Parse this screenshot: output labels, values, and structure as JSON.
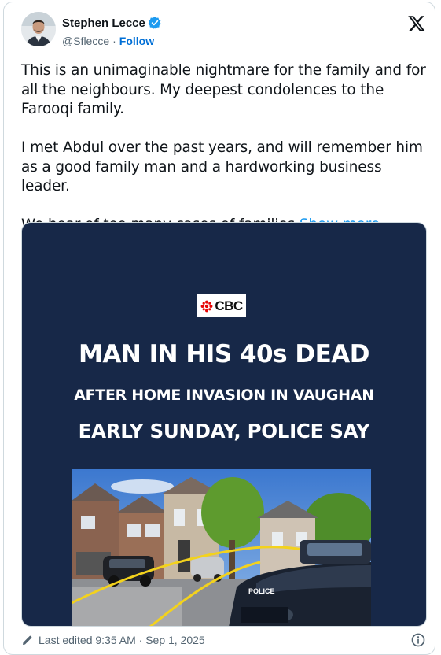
{
  "author": {
    "display_name": "Stephen Lecce",
    "handle": "@Sflecce",
    "separator": "·",
    "follow_label": "Follow"
  },
  "post": {
    "paragraphs": [
      "This is an unimaginable nightmare for the family and for all the neighbours. My deepest condolences to the Farooqi family.",
      "I met Abdul over the past years, and will remember him as a good family man and a hardworking business leader."
    ],
    "truncated_text": "We hear of too many cases of families",
    "show_more_label": "Show more"
  },
  "media": {
    "logo_text": "CBC",
    "headline_line1": "MAN IN HIS 40s DEAD",
    "headline_line2": "AFTER HOME INVASION IN VAUGHAN",
    "headline_line3": "EARLY SUNDAY, POLICE SAY",
    "police_car_label": "POLICE",
    "background_color": "#172848"
  },
  "footer": {
    "edited_text": "Last edited 9:35 AM · Sep 1, 2025"
  },
  "icons": {
    "verified": "verified-badge-icon",
    "platform": "x-logo-icon",
    "edit": "pencil-icon",
    "info": "info-icon"
  },
  "colors": {
    "accent": "#1d9bf0",
    "follow": "#006fd6",
    "text": "#0f1419",
    "muted": "#536471"
  }
}
